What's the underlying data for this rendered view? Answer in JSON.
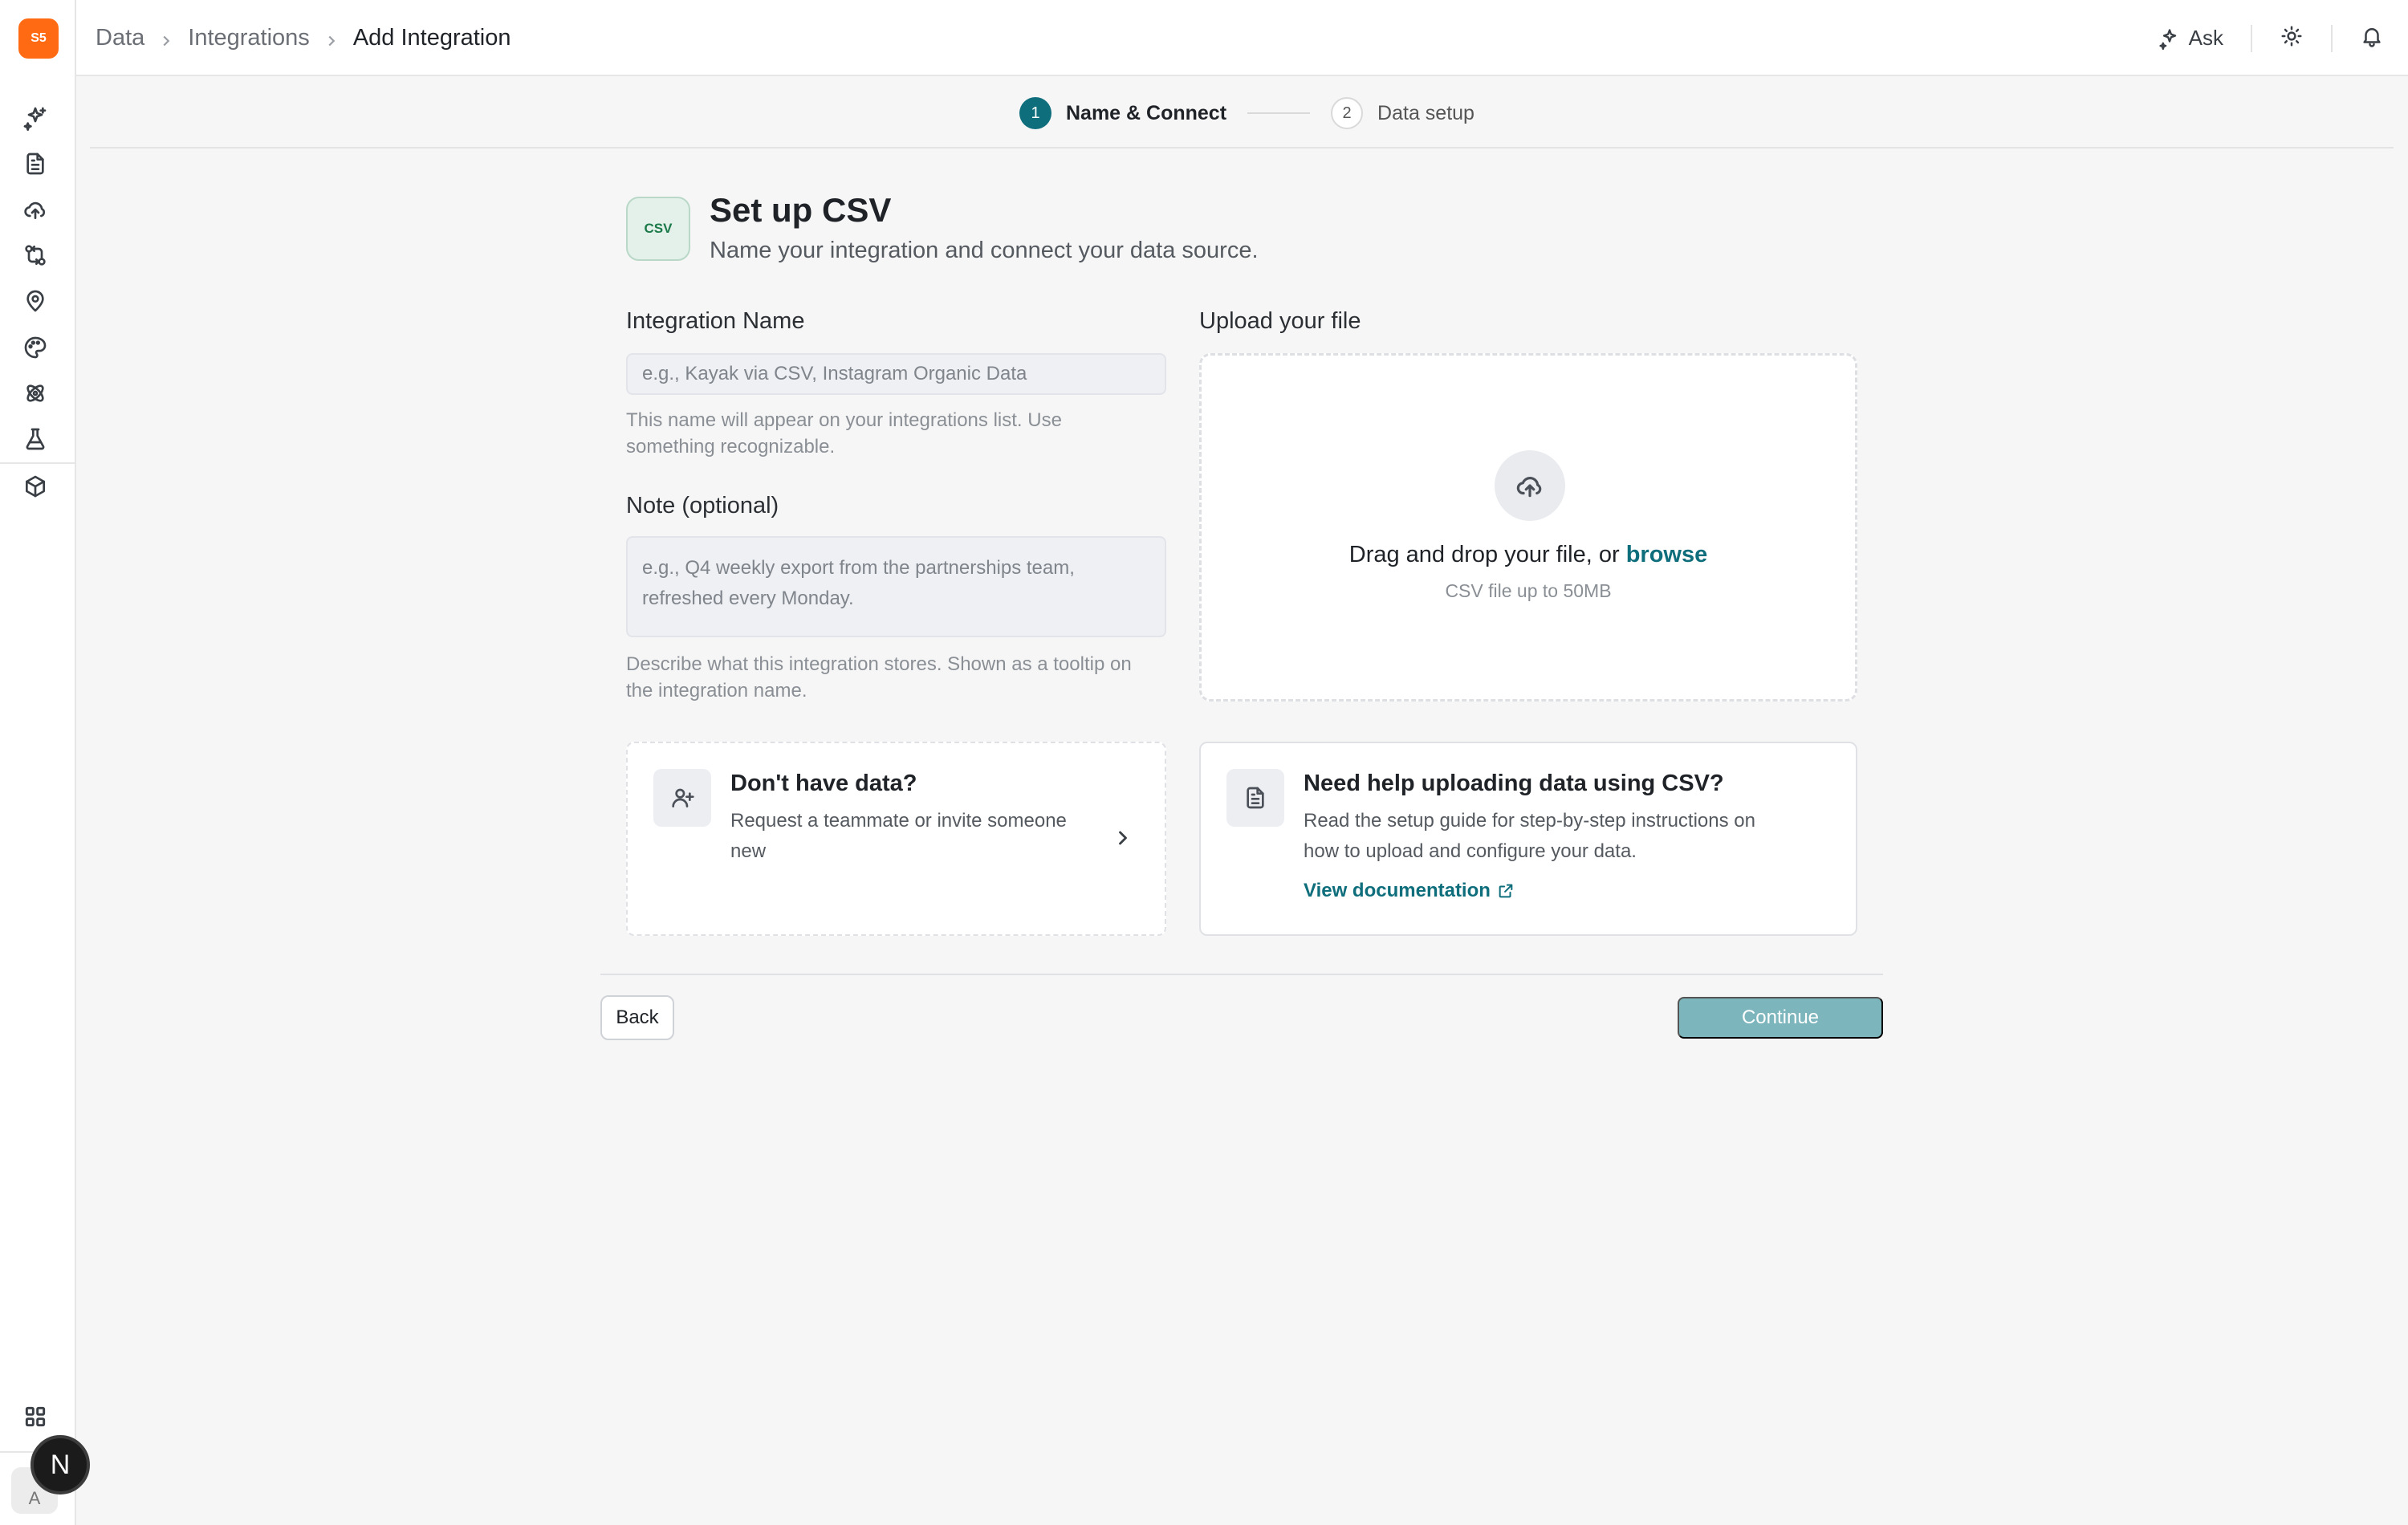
{
  "app": {
    "logo_text": "S5"
  },
  "sidebar": {
    "items": [
      {
        "icon": "sparkles-icon"
      },
      {
        "icon": "document-icon"
      },
      {
        "icon": "cloud-upload-icon"
      },
      {
        "icon": "git-compare-icon"
      },
      {
        "icon": "map-pin-icon"
      },
      {
        "icon": "palette-icon"
      },
      {
        "icon": "atom-icon"
      },
      {
        "icon": "flask-icon"
      },
      {
        "icon": "cube-icon"
      }
    ],
    "bottom_avatar": "A",
    "badge": "N"
  },
  "topbar": {
    "breadcrumb": [
      "Data",
      "Integrations",
      "Add Integration"
    ],
    "ask_label": "Ask"
  },
  "stepper": {
    "steps": [
      {
        "number": "1",
        "label": "Name & Connect",
        "active": true
      },
      {
        "number": "2",
        "label": "Data setup",
        "active": false
      }
    ]
  },
  "header": {
    "logo_text": "CSV",
    "title": "Set up CSV",
    "subtitle": "Name your integration and connect your data source."
  },
  "form": {
    "name_label": "Integration Name",
    "name_placeholder": "e.g., Kayak via CSV, Instagram Organic Data",
    "name_help_line1": "This name will appear on your integrations list. Use",
    "name_help_line2": "something recognizable.",
    "note_label": "Note (optional)",
    "note_placeholder_line1": "e.g., Q4 weekly export from the partnerships team,",
    "note_placeholder_line2": "refreshed every Monday.",
    "note_help_line1": "Describe what this integration stores. Shown as a tooltip on",
    "note_help_line2": "the integration name."
  },
  "upload": {
    "label": "Upload your file",
    "drop_text": "Drag and drop your file, or ",
    "browse": "browse",
    "sub": "CSV file up to 50MB"
  },
  "cards": {
    "no_data": {
      "title": "Don't have data?",
      "desc_line1": "Request a teammate or invite someone",
      "desc_line2": "new"
    },
    "help": {
      "title": "Need help uploading data using CSV?",
      "desc_line1": "Read the setup guide for step-by-step instructions on",
      "desc_line2": "how to upload and configure your data.",
      "link": "View documentation"
    }
  },
  "footer": {
    "back": "Back",
    "continue": "Continue"
  },
  "colors": {
    "accent": "#0f6e7c",
    "logo": "#ff6a13",
    "continue_disabled": "#7db5bd"
  }
}
